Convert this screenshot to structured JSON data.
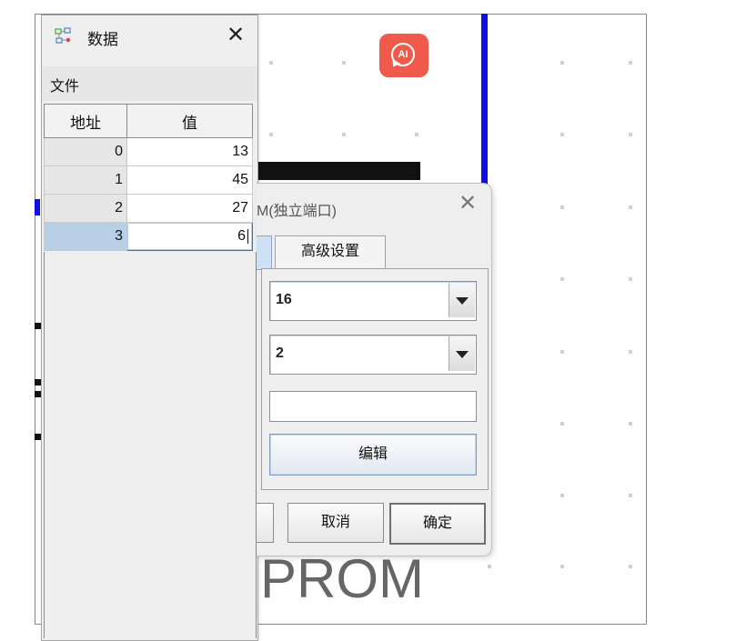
{
  "data_window": {
    "title": "数据",
    "close_symbol": "✕",
    "menu": {
      "file": "文件"
    },
    "table": {
      "columns": [
        "地址",
        "值"
      ],
      "rows": [
        {
          "address": "0",
          "value": "13"
        },
        {
          "address": "1",
          "value": "45"
        },
        {
          "address": "2",
          "value": "27"
        },
        {
          "address": "3",
          "value": "6"
        }
      ],
      "selected_row": 3
    }
  },
  "properties_dialog": {
    "title_partial": "M(独立端口)",
    "close_symbol": "✕",
    "tabs": {
      "advanced": "高级设置"
    },
    "combo_1_value": "16",
    "combo_2_value": "2",
    "text_field_value": "",
    "edit_button": "编辑",
    "cancel_button": "取消",
    "ok_button": "确定"
  },
  "canvas": {
    "component_label": "PROM",
    "ai_badge": "AI",
    "colors": {
      "wire_blue": "#1010e6",
      "ai_badge": "#f05a4a"
    }
  },
  "icons": {
    "data_window": "table-circuit-icon",
    "ai_badge": "ai-chat-icon",
    "dropdown": "triangle-down-icon"
  }
}
